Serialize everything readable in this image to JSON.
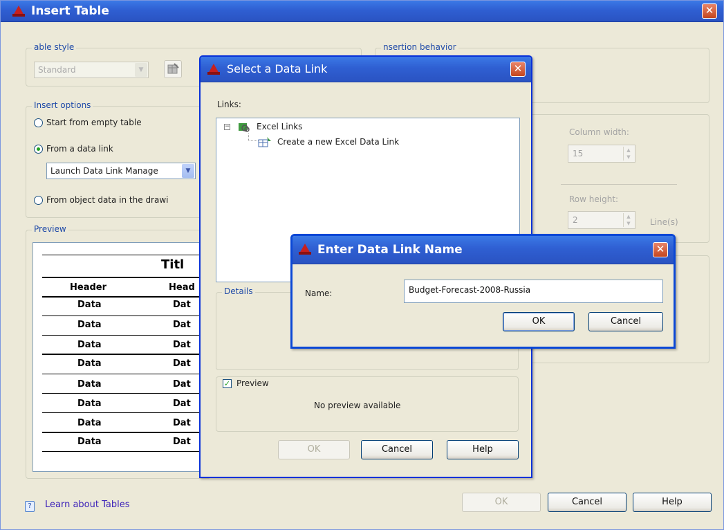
{
  "insert_table": {
    "title": "Insert Table",
    "table_style_group": "able style",
    "table_style_value": "Standard",
    "insertion_behavior_group": "nsertion behavior",
    "insert_options_group": "Insert options",
    "opt_empty": "Start from empty table",
    "opt_data_link": "From a data link",
    "data_link_combo": "Launch Data Link Manage",
    "opt_object_data": "From object data in the drawi",
    "preview_group": "Preview",
    "column_width_label": "Column width:",
    "column_width_value": "15",
    "row_height_label": "Row height:",
    "row_height_value": "2",
    "row_height_unit": "Line(s)",
    "learn_link": "Learn about Tables",
    "learn_icon_text": "?",
    "ok": "OK",
    "cancel": "Cancel",
    "help": "Help"
  },
  "preview_table": {
    "title": "Titl",
    "headers": [
      "Header",
      "Head"
    ],
    "rows": [
      [
        "Data",
        "Dat"
      ],
      [
        "Data",
        "Dat"
      ],
      [
        "Data",
        "Dat"
      ],
      [
        "Data",
        "Dat"
      ],
      [
        "Data",
        "Dat"
      ],
      [
        "Data",
        "Dat"
      ],
      [
        "Data",
        "Dat"
      ],
      [
        "Data",
        "Dat"
      ]
    ]
  },
  "select_data_link": {
    "title": "Select a Data Link",
    "links_label": "Links:",
    "tree_root": "Excel Links",
    "tree_child": "Create a new Excel Data Link",
    "details_group": "Details",
    "preview_checkbox": "Preview",
    "no_preview": "No preview available",
    "ok": "OK",
    "cancel": "Cancel",
    "help": "Help"
  },
  "enter_name": {
    "title": "Enter Data Link Name",
    "name_label": "Name:",
    "name_value": "Budget-Forecast-2008-Russia",
    "ok": "OK",
    "cancel": "Cancel"
  },
  "colors": {
    "title_blue": "#2f5fd2",
    "close_red": "#c4461f",
    "group_label": "#1f4aa8",
    "dialog_bg": "#ece9d8",
    "autocad_red": "#c8201e"
  }
}
